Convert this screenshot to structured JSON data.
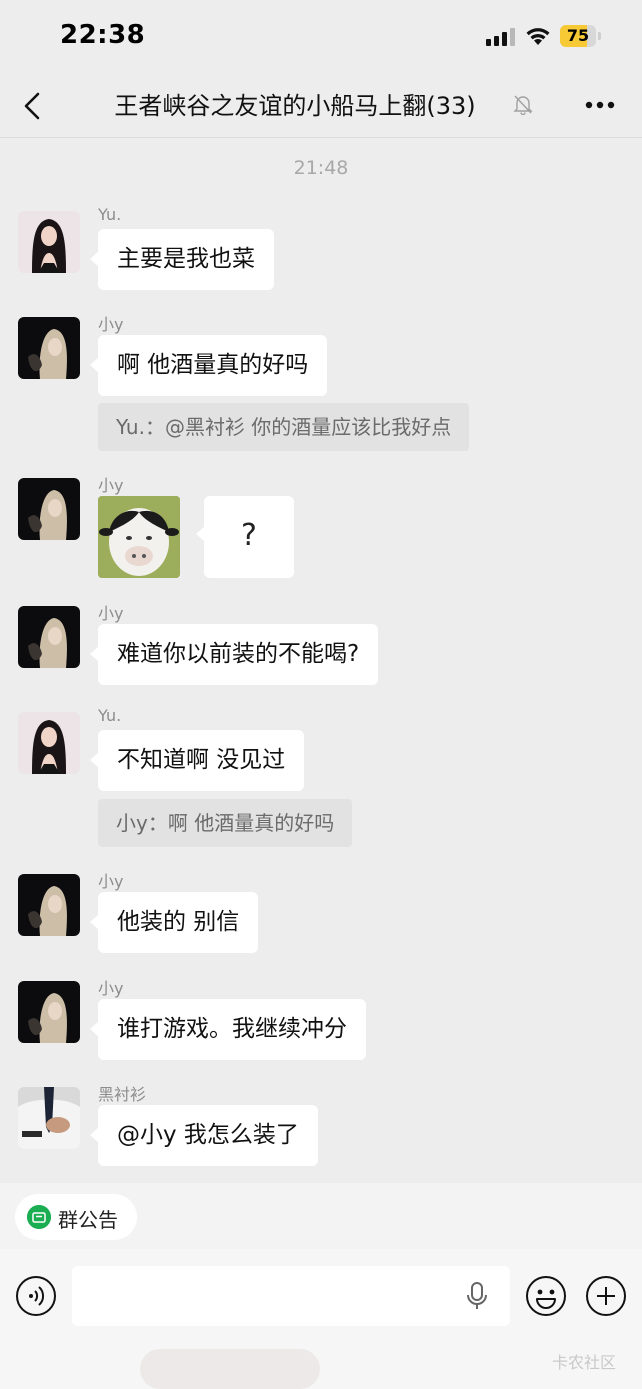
{
  "status_bar": {
    "time": "22:38",
    "battery": "75",
    "battery_level": 0.75,
    "battery_color": "#f6c935"
  },
  "nav": {
    "back_icon": "chevron-left-icon",
    "title": "王者峡谷之友谊的小船马上翻(33)",
    "mute_icon": "bell-slash-icon",
    "more_icon": "more-dots-icon"
  },
  "chat": {
    "timestamp": "21:48",
    "messages": [
      {
        "sender": "Yu.",
        "text": "主要是我也菜"
      },
      {
        "sender": "小y",
        "text": "啊 他酒量真的好吗",
        "quote": "Yu.：@黑衬衫 你的酒量应该比我好点"
      },
      {
        "sender": "小y",
        "text": "?"
      },
      {
        "sender": "小y",
        "text": "难道你以前装的不能喝?"
      },
      {
        "sender": "Yu.",
        "text": "不知道啊 没见过",
        "quote": "小y：啊 他酒量真的好吗"
      },
      {
        "sender": "小y",
        "text": "他装的 别信"
      },
      {
        "sender": "小y",
        "text": "谁打游戏。我继续冲分"
      },
      {
        "sender": "黑衬衫",
        "text": "@小y 我怎么装了"
      }
    ]
  },
  "notice": {
    "label": "群公告",
    "icon": "announcement-icon"
  },
  "input_bar": {
    "voice_icon": "voice-icon",
    "mic_icon": "microphone-icon",
    "emoji_icon": "emoji-icon",
    "plus_icon": "plus-circle-icon",
    "placeholder": ""
  },
  "watermark": "卡农社区",
  "colors": {
    "accent_green": "#1aad52",
    "bubble": "#ffffff",
    "background": "#ededed"
  }
}
